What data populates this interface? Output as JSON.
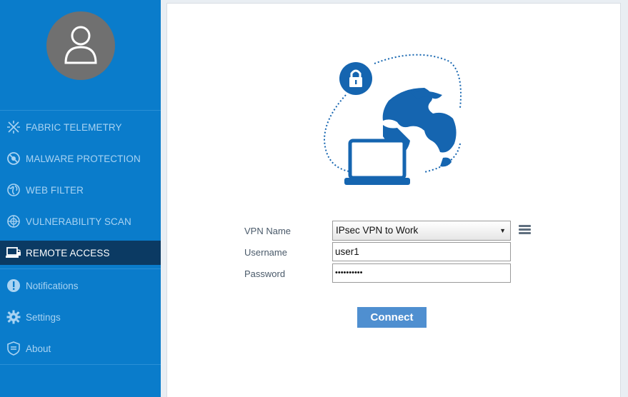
{
  "sidebar": {
    "items": [
      {
        "label": "FABRIC TELEMETRY",
        "icon": "fabric-telemetry-icon"
      },
      {
        "label": "MALWARE PROTECTION",
        "icon": "malware-protection-icon"
      },
      {
        "label": "WEB FILTER",
        "icon": "web-filter-icon"
      },
      {
        "label": "VULNERABILITY SCAN",
        "icon": "vulnerability-scan-icon"
      },
      {
        "label": "REMOTE ACCESS",
        "icon": "remote-access-icon",
        "active": true
      },
      {
        "label": "Notifications",
        "icon": "notifications-icon"
      },
      {
        "label": "Settings",
        "icon": "gear-icon"
      },
      {
        "label": "About",
        "icon": "about-icon"
      }
    ]
  },
  "form": {
    "vpn_name_label": "VPN Name",
    "vpn_name_value": "IPsec VPN to Work",
    "username_label": "Username",
    "username_value": "user1",
    "password_label": "Password",
    "password_value": "••••••••••",
    "connect_label": "Connect"
  },
  "colors": {
    "sidebar_bg": "#0a7ccb",
    "active_item_bg": "#0b3a63",
    "accent_blue": "#1565b0",
    "connect_button": "#4f8fd0"
  }
}
